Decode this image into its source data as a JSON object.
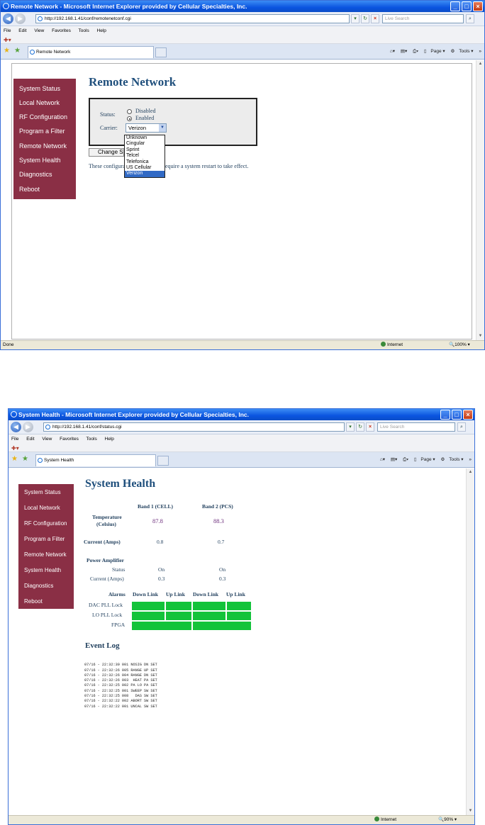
{
  "window1": {
    "title": "Remote Network - Microsoft Internet Explorer provided by Cellular Specialties, Inc.",
    "address": "http://192.168.1.41/conf/remotenetconf.cgi",
    "search_placeholder": "Live Search",
    "menu": [
      "File",
      "Edit",
      "View",
      "Favorites",
      "Tools",
      "Help"
    ],
    "tab_label": "Remote Network",
    "tools": [
      "Page",
      "Tools"
    ],
    "status_left": "Done",
    "status_zone": "Internet",
    "zoom": "100%",
    "nav": [
      "System Status",
      "Local Network",
      "RF Configuration",
      "Program a Filter",
      "Remote Network",
      "System Health",
      "Diagnostics",
      "Reboot"
    ],
    "page_title": "Remote Network",
    "status_label": "Status:",
    "status_options": [
      "Disabled",
      "Enabled"
    ],
    "status_selected": "Enabled",
    "carrier_label": "Carrier:",
    "carrier_value": "Verizon",
    "carrier_options": [
      "Unknown",
      "Cingular",
      "Sprint",
      "Telcel",
      "Telefonica",
      "US Cellular",
      "Verizon"
    ],
    "change_button": "Change Se",
    "note_left": "These configura",
    "note_right": "equire a system restart to take effect."
  },
  "window2": {
    "title": "System Health - Microsoft Internet Explorer provided by Cellular Specialties, Inc.",
    "address": "http://192.168.1.41/conf/status.cgi",
    "search_placeholder": "Live Search",
    "menu": [
      "File",
      "Edit",
      "View",
      "Favorites",
      "Tools",
      "Help"
    ],
    "tab_label": "System Health",
    "tools": [
      "Page",
      "Tools"
    ],
    "status_zone": "Internet",
    "zoom": "90%",
    "nav": [
      "System Status",
      "Local Network",
      "RF Configuration",
      "Program a Filter",
      "Remote Network",
      "System Health",
      "Diagnostics",
      "Reboot"
    ],
    "page_title": "System Health",
    "band1": "Band 1 (CELL)",
    "band2": "Band 2 (PCS)",
    "temp_label_1": "Temperature",
    "temp_label_2": "(Celsius)",
    "temp_values": [
      "87.8",
      "88.3"
    ],
    "current_label": "Current (Amps)",
    "current_values": [
      "0.8",
      "0.7"
    ],
    "pa_label": "Power Amplifier",
    "pa_status_label": "Status",
    "pa_status_values": [
      "On",
      "On"
    ],
    "pa_current_label": "Current (Amps)",
    "pa_current_values": [
      "0.3",
      "0.3"
    ],
    "alarms_label": "Alarms",
    "alarm_cols": [
      "Down Link",
      "Up Link",
      "Down Link",
      "Up Link"
    ],
    "alarm_rows": [
      "DAC PLL Lock",
      "LO PLL Lock",
      "FPGA"
    ],
    "alarm_color": "#13c33a",
    "event_log_title": "Event Log",
    "event_log": [
      "07/16 - 22:32:30 001 NOSIG DN SET",
      "07/16 - 22:32:26 005 RANGE UP SET",
      "07/16 - 22:32:26 004 RANGE DN SET",
      "07/16 - 22:32:26 003  HEAT PA SET",
      "07/16 - 22:32:25 002 PA LO PA SET",
      "07/16 - 22:32:25 001 SWEEP SW SET",
      "07/16 - 22:32:25 008   DAS SW SET",
      "07/16 - 22:32:22 002 ABORT SW SET",
      "07/16 - 22:32:22 001 UNCAL SW SET"
    ]
  },
  "colors": {
    "nav_bg": "#8a2f45",
    "title_blue": "#1f4f7c",
    "titlebar": "#0a54e0"
  }
}
